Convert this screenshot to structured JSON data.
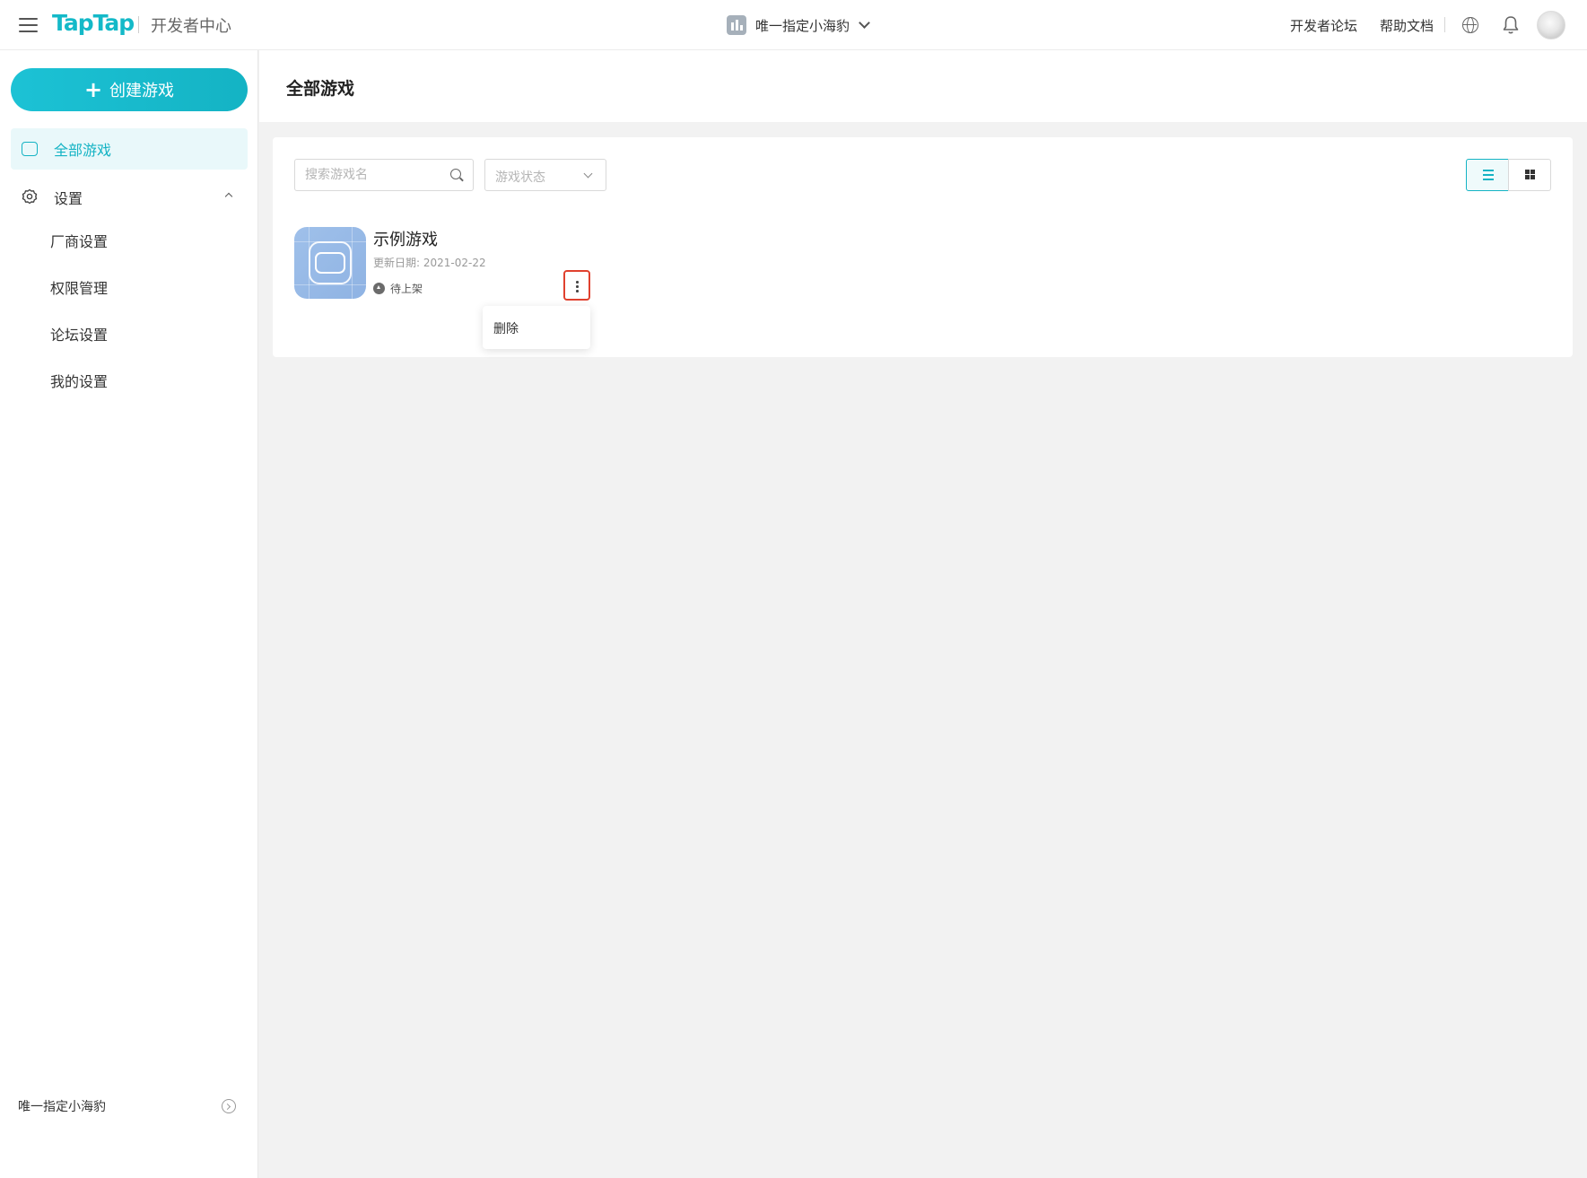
{
  "header": {
    "logo": "TapTap",
    "subtitle": "开发者中心",
    "org_name": "唯一指定小海豹",
    "links": [
      "开发者论坛",
      "帮助文档"
    ]
  },
  "sidebar": {
    "create_label": "创建游戏",
    "nav_all_games": "全部游戏",
    "nav_settings": "设置",
    "sub_items": [
      "厂商设置",
      "权限管理",
      "论坛设置",
      "我的设置"
    ],
    "footer_name": "唯一指定小海豹"
  },
  "main": {
    "page_title": "全部游戏",
    "search_placeholder": "搜索游戏名",
    "status_placeholder": "游戏状态",
    "game": {
      "name": "示例游戏",
      "updated": "更新日期: 2021-02-22",
      "status": "待上架"
    },
    "dropdown_items": [
      "删除"
    ]
  },
  "colors": {
    "accent": "#14b3c4",
    "highlight_border": "#e0412e",
    "icon_bg": "#9fc0ea"
  }
}
